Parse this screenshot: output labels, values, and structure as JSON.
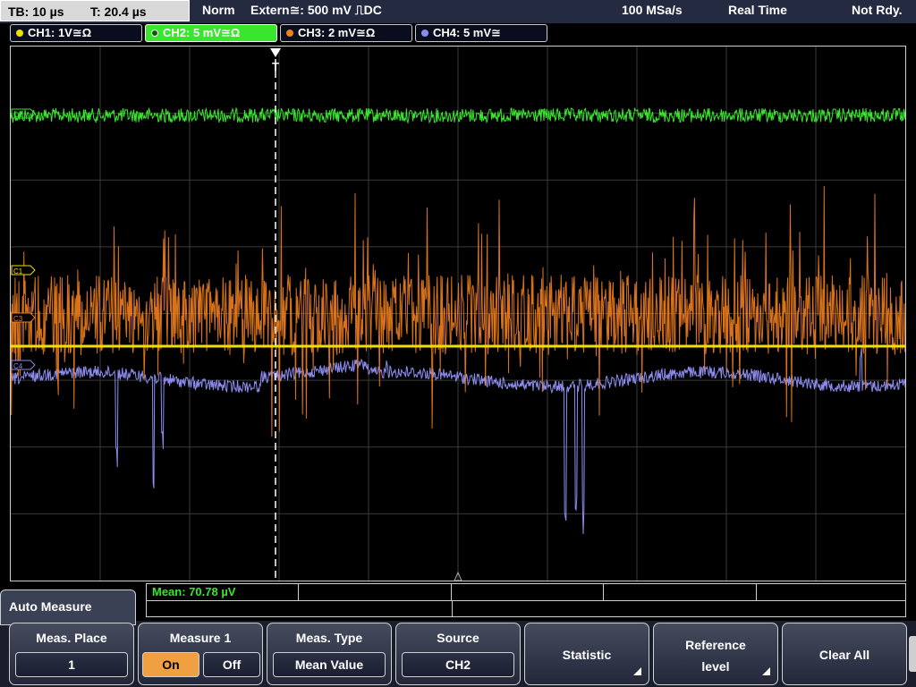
{
  "topbar": {
    "timebase": "TB: 10 µs",
    "trigger_time": "T: 20.4 µs",
    "mode": "Norm",
    "trigger_source": "Extern≅: 500 mV ⎍DC",
    "sample_rate": "100 MSa/s",
    "acq_mode": "Real Time",
    "status": "Not Rdy."
  },
  "channels": [
    {
      "label": "CH1: 1V≅Ω",
      "color": "#f0e000"
    },
    {
      "label": "CH2: 5 mV≅Ω",
      "color": "#39e62d",
      "active": true
    },
    {
      "label": "CH3: 2 mV≅Ω",
      "color": "#f07f1e"
    },
    {
      "label": "CH4: 5 mV≅",
      "color": "#8c8cf0"
    }
  ],
  "markers": {
    "c2": "C2",
    "c1": "C1",
    "c3": "C3",
    "c4": "C4",
    "trigger": "T"
  },
  "colors": {
    "ch1": "#f0e000",
    "ch2": "#39e62d",
    "ch3": "#f07f1e",
    "ch4": "#8c8cf0",
    "grid": "#3a3a3a",
    "menu_active": "#f0a040"
  },
  "measurement": {
    "result": "Mean: 70.78 µV"
  },
  "menu": {
    "title": "Auto Measure",
    "meas_place_label": "Meas. Place",
    "meas_place_value": "1",
    "measure1_label": "Measure 1",
    "on_label": "On",
    "off_label": "Off",
    "meas_type_label": "Meas. Type",
    "meas_type_value": "Mean Value",
    "source_label": "Source",
    "source_value": "CH2",
    "statistic_label": "Statistic",
    "reference_label_1": "Reference",
    "reference_label_2": "level",
    "clear_all_label": "Clear All"
  }
}
